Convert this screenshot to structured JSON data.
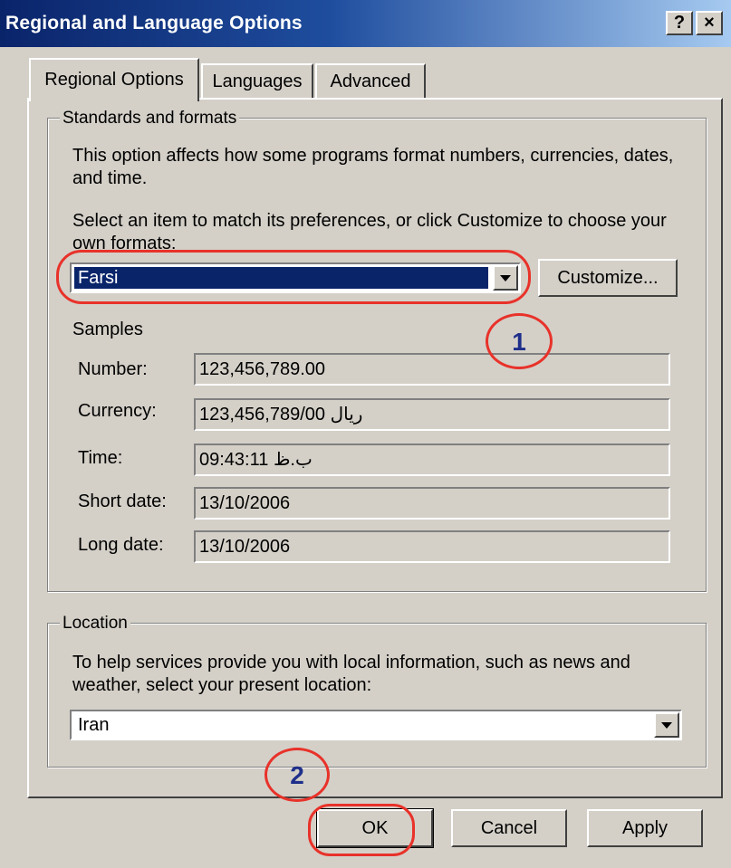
{
  "window": {
    "title": "Regional and Language Options",
    "help_label": "?",
    "close_label": "×"
  },
  "tabs": [
    {
      "label": "Regional Options",
      "active": true
    },
    {
      "label": "Languages",
      "active": false
    },
    {
      "label": "Advanced",
      "active": false
    }
  ],
  "standards": {
    "legend": "Standards and formats",
    "description": "This option affects how some programs format numbers, currencies, dates, and time.",
    "select_prompt": "Select an item to match its preferences, or click Customize to choose your own formats:",
    "selected_locale": "Farsi",
    "customize_label": "Customize...",
    "samples_label": "Samples",
    "samples": [
      {
        "label": "Number:",
        "value": "123,456,789.00"
      },
      {
        "label": "Currency:",
        "value": "123,456,789/00 ريال"
      },
      {
        "label": "Time:",
        "value": "09:43:11 ب.ظ"
      },
      {
        "label": "Short date:",
        "value": "13/10/2006"
      },
      {
        "label": "Long date:",
        "value": "13/10/2006"
      }
    ]
  },
  "location": {
    "legend": "Location",
    "description": "To help services provide you with local information, such as news and weather, select your present location:",
    "selected": "Iran"
  },
  "buttons": {
    "ok": "OK",
    "cancel": "Cancel",
    "apply": "Apply"
  },
  "annotations": {
    "step1": "1",
    "step2": "2",
    "color": "#e8322a",
    "number_color": "#1f2f8a"
  }
}
